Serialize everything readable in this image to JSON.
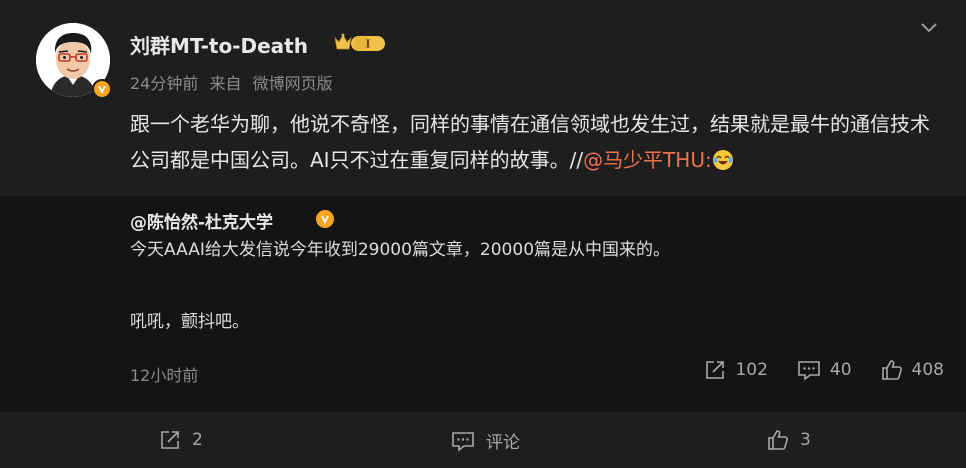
{
  "post": {
    "username": "刘群MT-to-Death",
    "level_badge": "I",
    "time": "24分钟前",
    "source_prefix": "来自",
    "source": "微博网页版",
    "text": "跟一个老华为聊，他说不奇怪，同样的事情在通信领域也发生过，结果就是最牛的通信技术公司都是中国公司。AI只不过在重复同样的故事。//",
    "mention": "@马少平THU",
    "mention_suffix": ":"
  },
  "repost": {
    "author": "@陈怡然-杜克大学",
    "text_line1": "今天AAAI给大发信说今年收到29000篇文章，20000篇是从中国来的。",
    "text_line2": "吼吼，颤抖吧。",
    "time": "12小时前",
    "share_count": "102",
    "comment_count": "40",
    "like_count": "408"
  },
  "footer": {
    "share_count": "2",
    "comment_label": "评论",
    "like_count": "3"
  },
  "colors": {
    "background": "#1e1e1e",
    "repost_background": "#141414",
    "mention": "#eb7350",
    "badge_orange": "#f6a623"
  }
}
